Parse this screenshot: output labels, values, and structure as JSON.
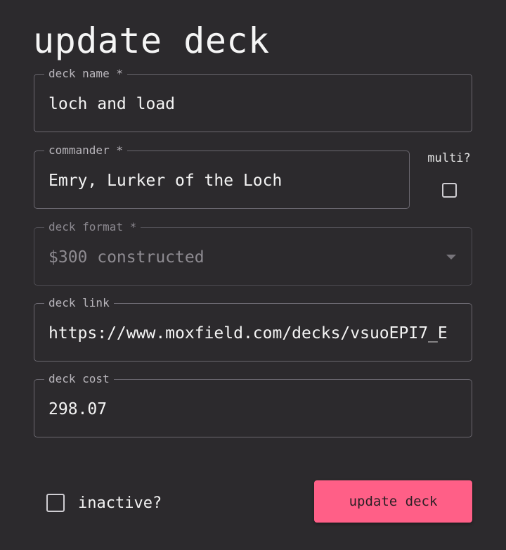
{
  "dialog": {
    "title": "update deck"
  },
  "fields": {
    "deck_name": {
      "label": "deck name *",
      "value": "loch and load"
    },
    "commander": {
      "label": "commander *",
      "value": "Emry, Lurker of the Loch"
    },
    "multi": {
      "label": "multi?",
      "checked": false
    },
    "deck_format": {
      "label": "deck format *",
      "value": "$300 constructed",
      "disabled": true
    },
    "deck_link": {
      "label": "deck link",
      "value": "https://www.moxfield.com/decks/vsuoEPI7_E"
    },
    "deck_cost": {
      "label": "deck cost",
      "value": "298.07"
    }
  },
  "footer": {
    "inactive_label": "inactive?",
    "inactive_checked": false,
    "submit_label": "update deck"
  },
  "colors": {
    "background": "#2c2a2d",
    "accent": "#ff5f87",
    "border": "#6b6870"
  }
}
